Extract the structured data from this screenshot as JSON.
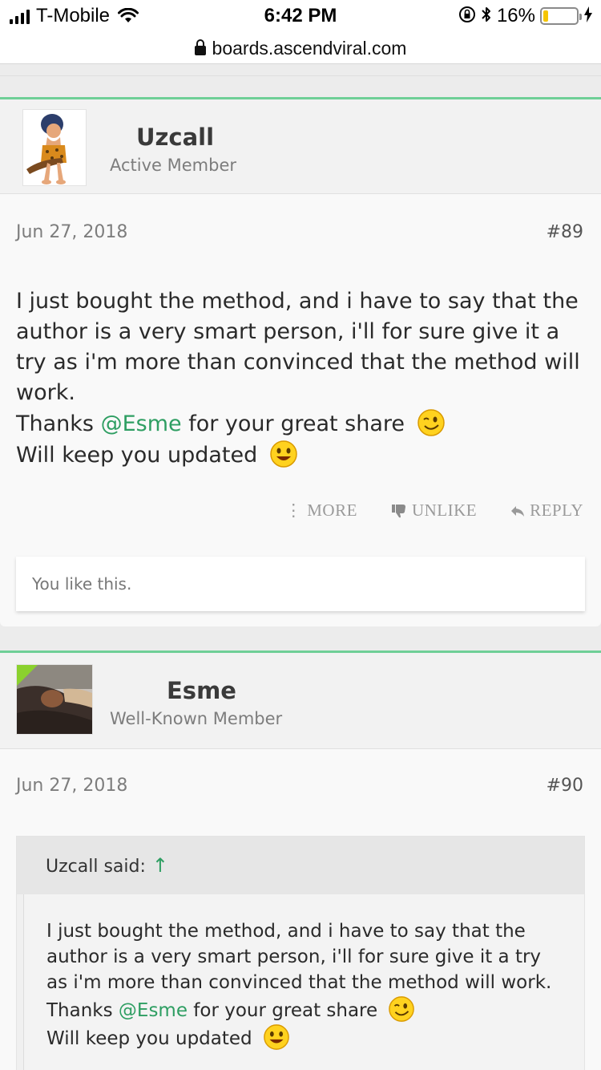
{
  "status_bar": {
    "carrier": "T-Mobile",
    "time": "6:42 PM",
    "battery_pct": "16%",
    "battery_level": 0.16,
    "battery_color": "#f5c500"
  },
  "browser": {
    "url": "boards.ascendviral.com"
  },
  "colors": {
    "accent_green": "#6fcf97",
    "mention_green": "#2e9e62",
    "new_flag": "#8bd12e"
  },
  "posts": [
    {
      "username": "Uzcall",
      "user_title": "Active Member",
      "avatar_icon": "caveman-avatar-icon",
      "date": "Jun 27, 2018",
      "post_number": "#89",
      "body_line1": "I just bought the method, and i have to say that the author is a very smart person, i'll for sure give it a try as i'm more than convinced that the method will work.",
      "thanks_pre": "Thanks ",
      "mention": "@Esme",
      "thanks_post": " for your great share",
      "update_line": "Will keep you updated",
      "actions": {
        "more": "MORE",
        "unlike": "UNLIKE",
        "reply": "REPLY"
      },
      "likes_text": "You like this."
    },
    {
      "username": "Esme",
      "user_title": "Well-Known Member",
      "avatar_icon": "profile-photo-avatar",
      "date": "Jun 27, 2018",
      "post_number": "#90",
      "quote": {
        "author_said": "Uzcall said:",
        "arrow": "↑",
        "body_line1": "I just bought the method, and i have to say that the author is a very smart person, i'll for sure give it a try as i'm more than convinced that the method will work.",
        "thanks_pre": "Thanks ",
        "mention": "@Esme",
        "thanks_post": " for your great share",
        "update_line": "Will keep you updated"
      }
    }
  ]
}
